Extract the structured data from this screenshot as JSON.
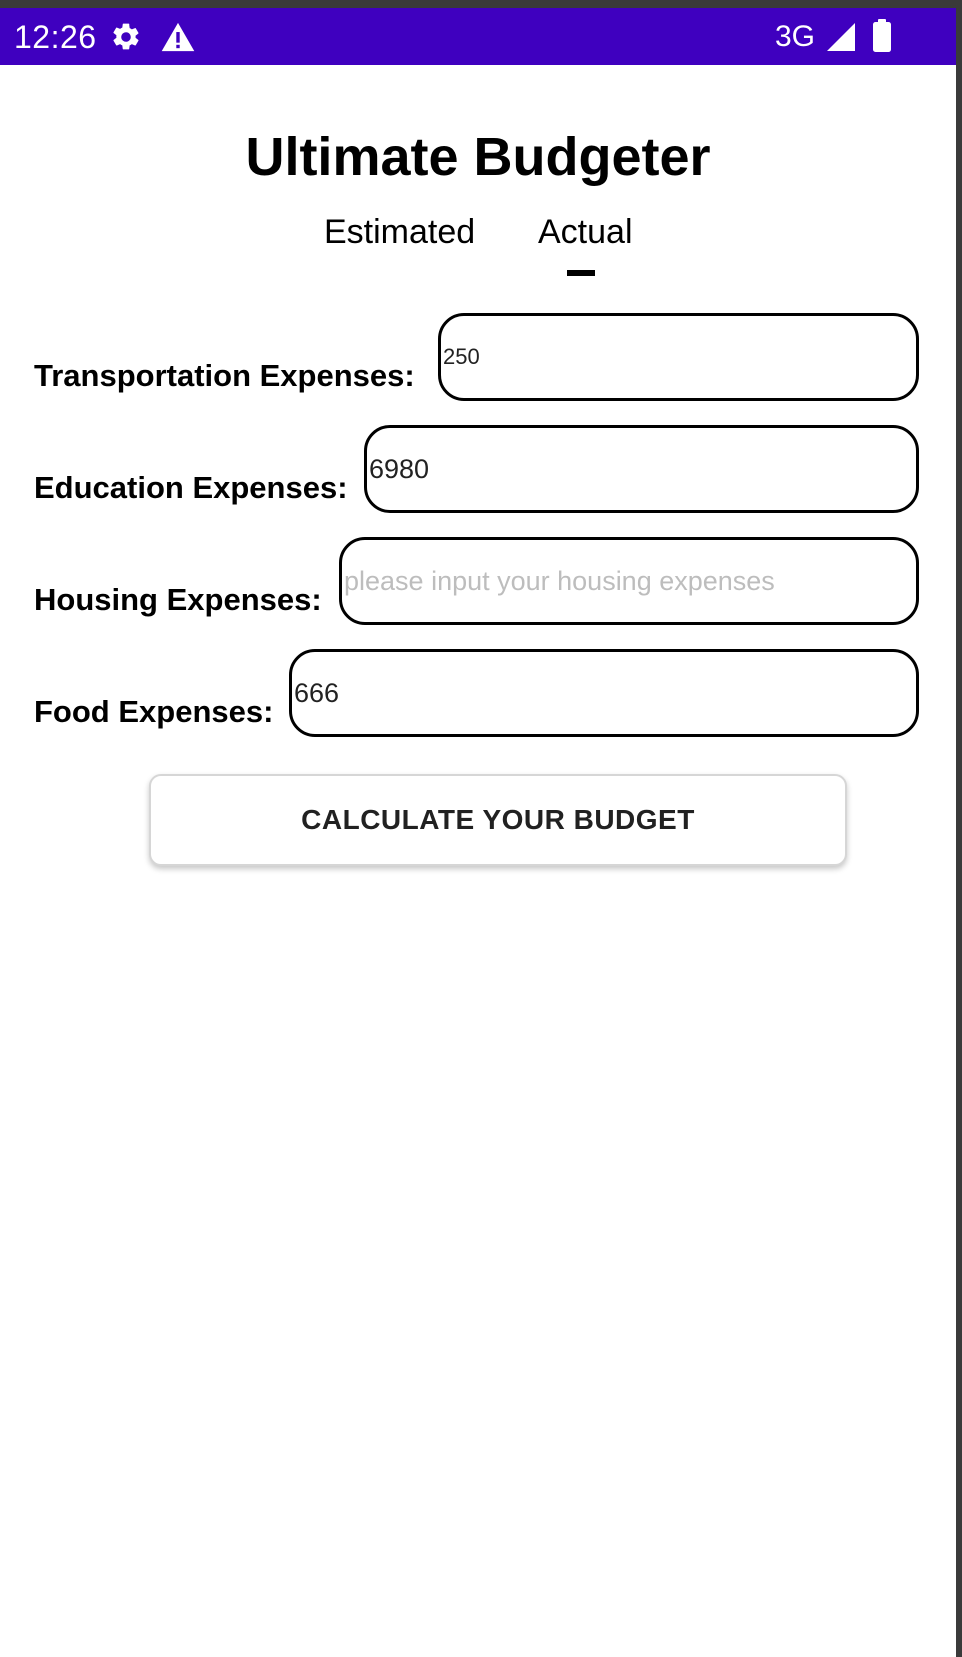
{
  "status_bar": {
    "time": "12:26",
    "network": "3G",
    "background_color": "#3f00bf",
    "icons": [
      "gear-icon",
      "warning-icon",
      "signal-icon",
      "battery-icon"
    ]
  },
  "app": {
    "title": "Ultimate Budgeter"
  },
  "tabs": [
    {
      "label": "Estimated",
      "selected": false
    },
    {
      "label": "Actual",
      "selected": true
    }
  ],
  "form": {
    "transportation": {
      "label": "Transportation Expenses:",
      "value": "250",
      "placeholder": ""
    },
    "education": {
      "label": "Education Expenses:",
      "value": "6980",
      "placeholder": ""
    },
    "housing": {
      "label": "Housing Expenses:",
      "value": "",
      "placeholder": "please input your housing expenses"
    },
    "food": {
      "label": "Food Expenses:",
      "value": "666",
      "placeholder": ""
    }
  },
  "actions": {
    "calculate_label": "CALCULATE YOUR BUDGET"
  }
}
